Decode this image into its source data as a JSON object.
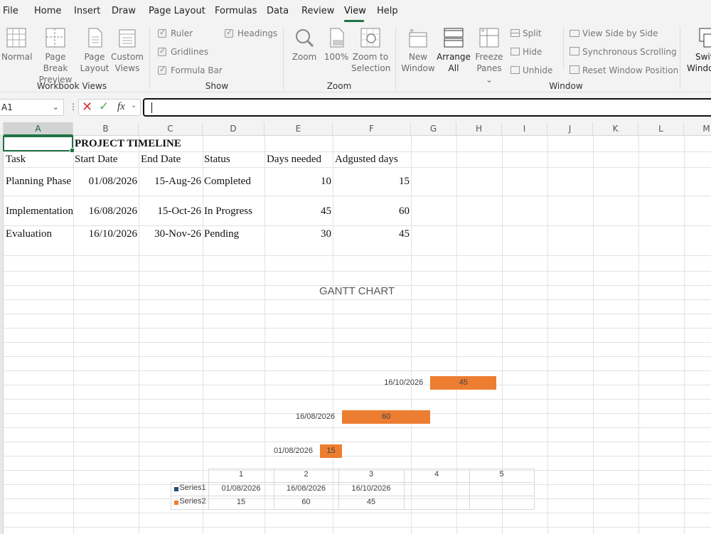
{
  "menu": [
    "File",
    "Home",
    "Insert",
    "Draw",
    "Page Layout",
    "Formulas",
    "Data",
    "Review",
    "View",
    "Help"
  ],
  "ribbon": {
    "workbook_views": {
      "normal": "Normal",
      "page_break_1": "Page Break",
      "page_break_2": "Preview",
      "page_layout_1": "Page",
      "page_layout_2": "Layout",
      "custom_views_1": "Custom",
      "custom_views_2": "Views",
      "label": "Workbook Views"
    },
    "show": {
      "ruler": "Ruler",
      "gridlines": "Gridlines",
      "formula_bar": "Formula Bar",
      "headings": "Headings",
      "label": "Show"
    },
    "zoom": {
      "zoom": "Zoom",
      "hundred": "100%",
      "zoom_sel_1": "Zoom to",
      "zoom_sel_2": "Selection",
      "label": "Zoom"
    },
    "window": {
      "new_window_1": "New",
      "new_window_2": "Window",
      "arrange_1": "Arrange",
      "arrange_2": "All",
      "freeze_1": "Freeze",
      "freeze_2": "Panes",
      "split": "Split",
      "hide": "Hide",
      "unhide": "Unhide",
      "side_by_side": "View Side by Side",
      "sync_scroll": "Synchronous Scrolling",
      "reset_pos": "Reset Window Position",
      "switch_1": "Swit",
      "switch_2": "Windo",
      "label": "Window"
    }
  },
  "formula_bar": {
    "name_box": "A1",
    "fx": "fx",
    "content": ""
  },
  "columns": [
    "A",
    "B",
    "C",
    "D",
    "E",
    "F",
    "G",
    "H",
    "I",
    "J",
    "K",
    "L",
    "M"
  ],
  "sheet": {
    "title": "PROJECT TIMELINE",
    "headers": [
      "Task",
      "Start Date",
      "End Date",
      "Status",
      "Days needed",
      "Adgusted days"
    ],
    "rows": [
      [
        "Planning Phase",
        "01/08/2026",
        "15-Aug-26",
        "Completed",
        "10",
        "15"
      ],
      [
        "Implementation",
        "16/08/2026",
        "15-Oct-26",
        "In Progress",
        "45",
        "60"
      ],
      [
        "Evaluation",
        "16/10/2026",
        "30-Nov-26",
        "Pending",
        "30",
        "45"
      ]
    ]
  },
  "chart_data": {
    "type": "bar",
    "title": "GANTT CHART",
    "orientation": "horizontal-stacked",
    "categories": [
      "01/08/2026",
      "16/08/2026",
      "16/10/2026"
    ],
    "series": [
      {
        "name": "Series1",
        "values": [
          "01/08/2026",
          "16/08/2026",
          "16/10/2026"
        ],
        "visible": false,
        "color": "#1f4e79"
      },
      {
        "name": "Series2",
        "values": [
          15,
          60,
          45
        ],
        "visible": true,
        "color": "#ed7d31"
      }
    ],
    "data_table": {
      "columns": [
        "1",
        "2",
        "3",
        "4",
        "5"
      ]
    }
  },
  "colors": {
    "accent": "#217346",
    "bar": "#ed7d31",
    "series1": "#1f4e79"
  }
}
